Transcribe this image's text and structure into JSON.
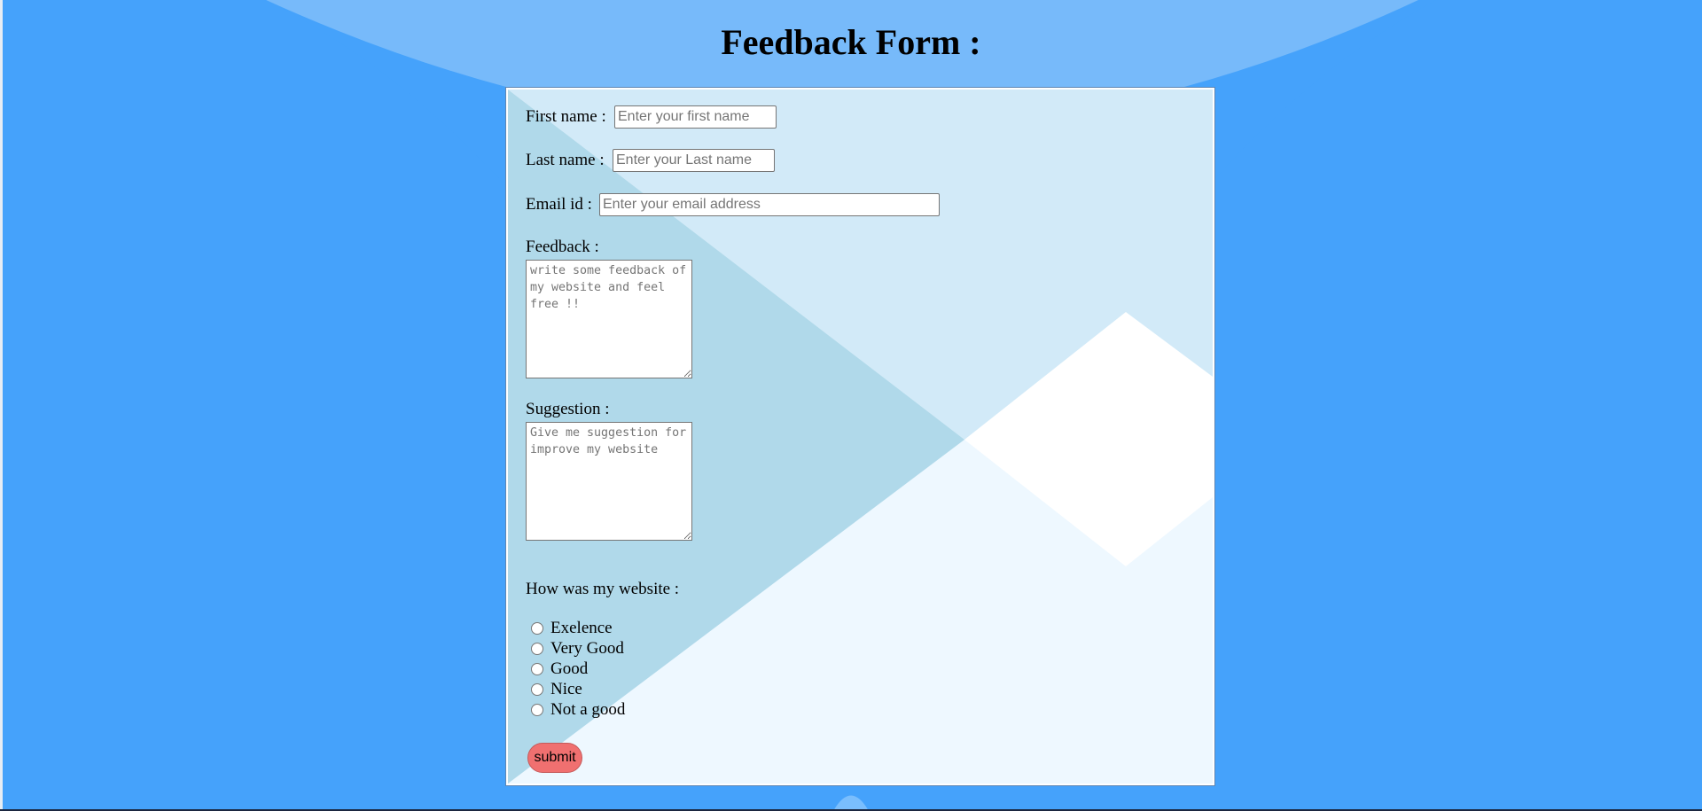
{
  "page": {
    "title": "Feedback Form :",
    "background_color": "#45a2fb"
  },
  "form": {
    "first_name": {
      "label": "First name :",
      "placeholder": "Enter your first name",
      "value": ""
    },
    "last_name": {
      "label": "Last name :",
      "placeholder": "Enter your Last name",
      "value": ""
    },
    "email": {
      "label": "Email id :",
      "placeholder": "Enter your email address",
      "value": ""
    },
    "feedback": {
      "label": "Feedback :",
      "placeholder": "write some feedback of my website and feel free !!"
    },
    "suggestion": {
      "label": "Suggestion :",
      "placeholder": "Give me suggestion for improve my website"
    },
    "rating": {
      "question": "How was my website :",
      "options": [
        "Exelence",
        "Very Good",
        "Good",
        "Nice",
        "Not a good"
      ],
      "selected": null
    },
    "submit_label": "submit",
    "submit_color": "#f07070"
  }
}
